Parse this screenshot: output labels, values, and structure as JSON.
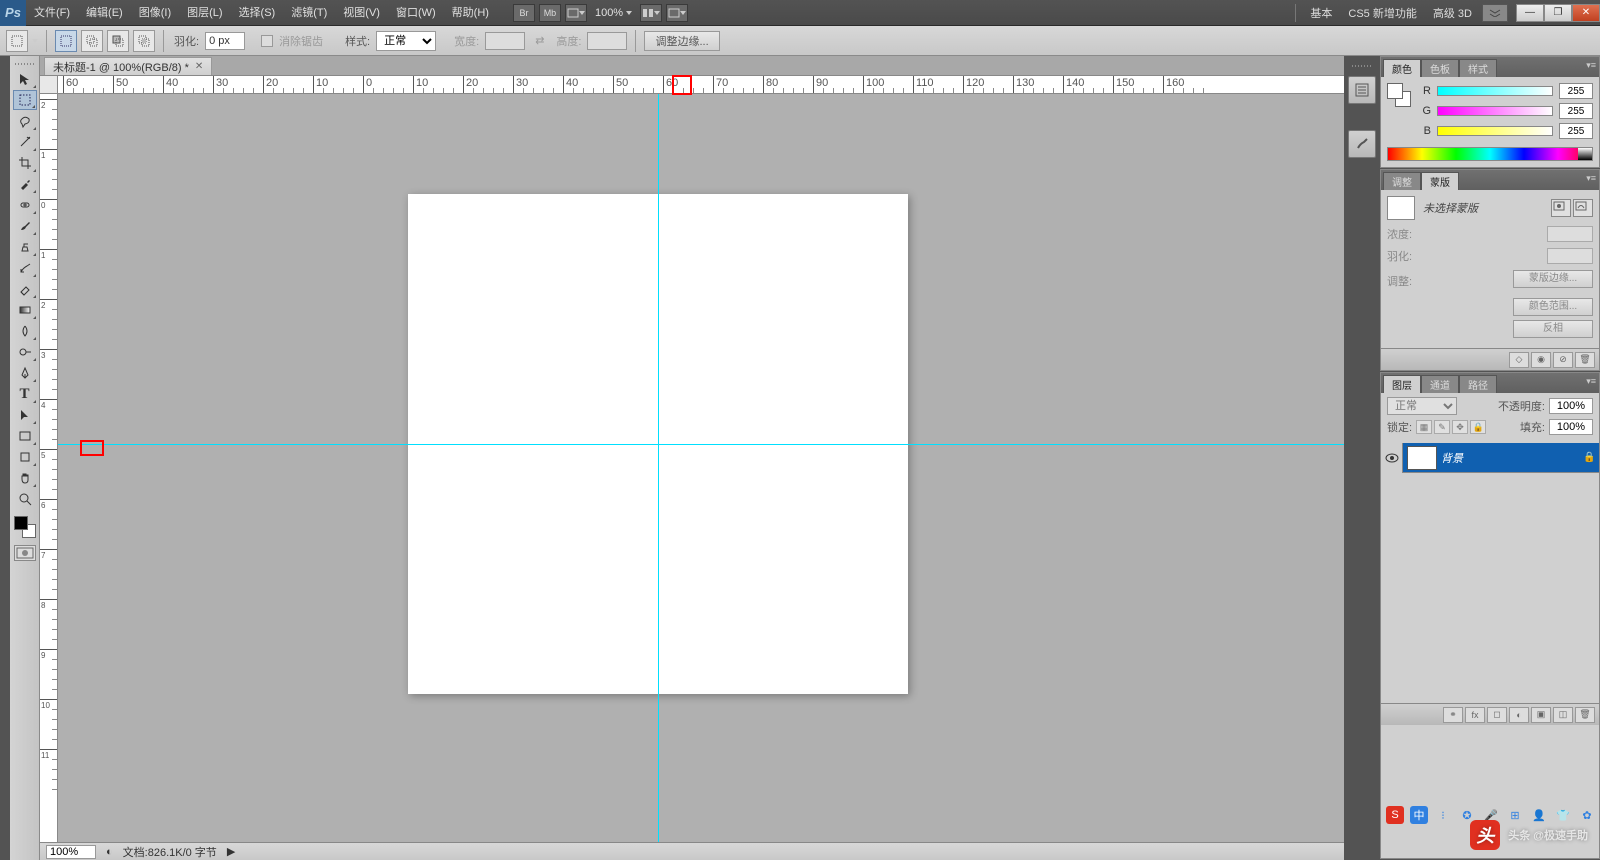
{
  "app": {
    "logo": "Ps"
  },
  "menubar": {
    "items": [
      "文件(F)",
      "编辑(E)",
      "图像(I)",
      "图层(L)",
      "选择(S)",
      "滤镜(T)",
      "视图(V)",
      "窗口(W)",
      "帮助(H)"
    ],
    "mini": [
      "Br",
      "Mb"
    ],
    "zoom": "100%",
    "workspace": [
      "基本",
      "CS5 新增功能",
      "高级 3D"
    ]
  },
  "optionsbar": {
    "feather_label": "羽化:",
    "feather_value": "0 px",
    "antialias": "消除锯齿",
    "style_label": "样式:",
    "style_value": "正常",
    "width_label": "宽度:",
    "height_label": "高度:",
    "refine": "调整边缘..."
  },
  "document": {
    "tab_title": "未标题-1 @ 100%(RGB/8) *"
  },
  "status": {
    "zoom": "100%",
    "info": "文档:826.1K/0 字节"
  },
  "panels": {
    "color": {
      "tabs": [
        "颜色",
        "色板",
        "样式"
      ],
      "r_label": "R",
      "g_label": "G",
      "b_label": "B",
      "r": "255",
      "g": "255",
      "b": "255"
    },
    "mask": {
      "tabs": [
        "调整",
        "蒙版"
      ],
      "empty": "未选择蒙版",
      "density": "浓度:",
      "feather": "羽化:",
      "adjust": "调整:",
      "btn_edge": "蒙版边缘...",
      "btn_range": "颜色范围...",
      "btn_invert": "反相"
    },
    "layers": {
      "tabs": [
        "图层",
        "通道",
        "路径"
      ],
      "blend": "正常",
      "opacity_label": "不透明度:",
      "opacity": "100%",
      "lock_label": "锁定:",
      "fill_label": "填充:",
      "fill": "100%",
      "layer_name": "背景"
    }
  },
  "watermark": {
    "logo": "头",
    "text": "头条 @极速手助"
  }
}
